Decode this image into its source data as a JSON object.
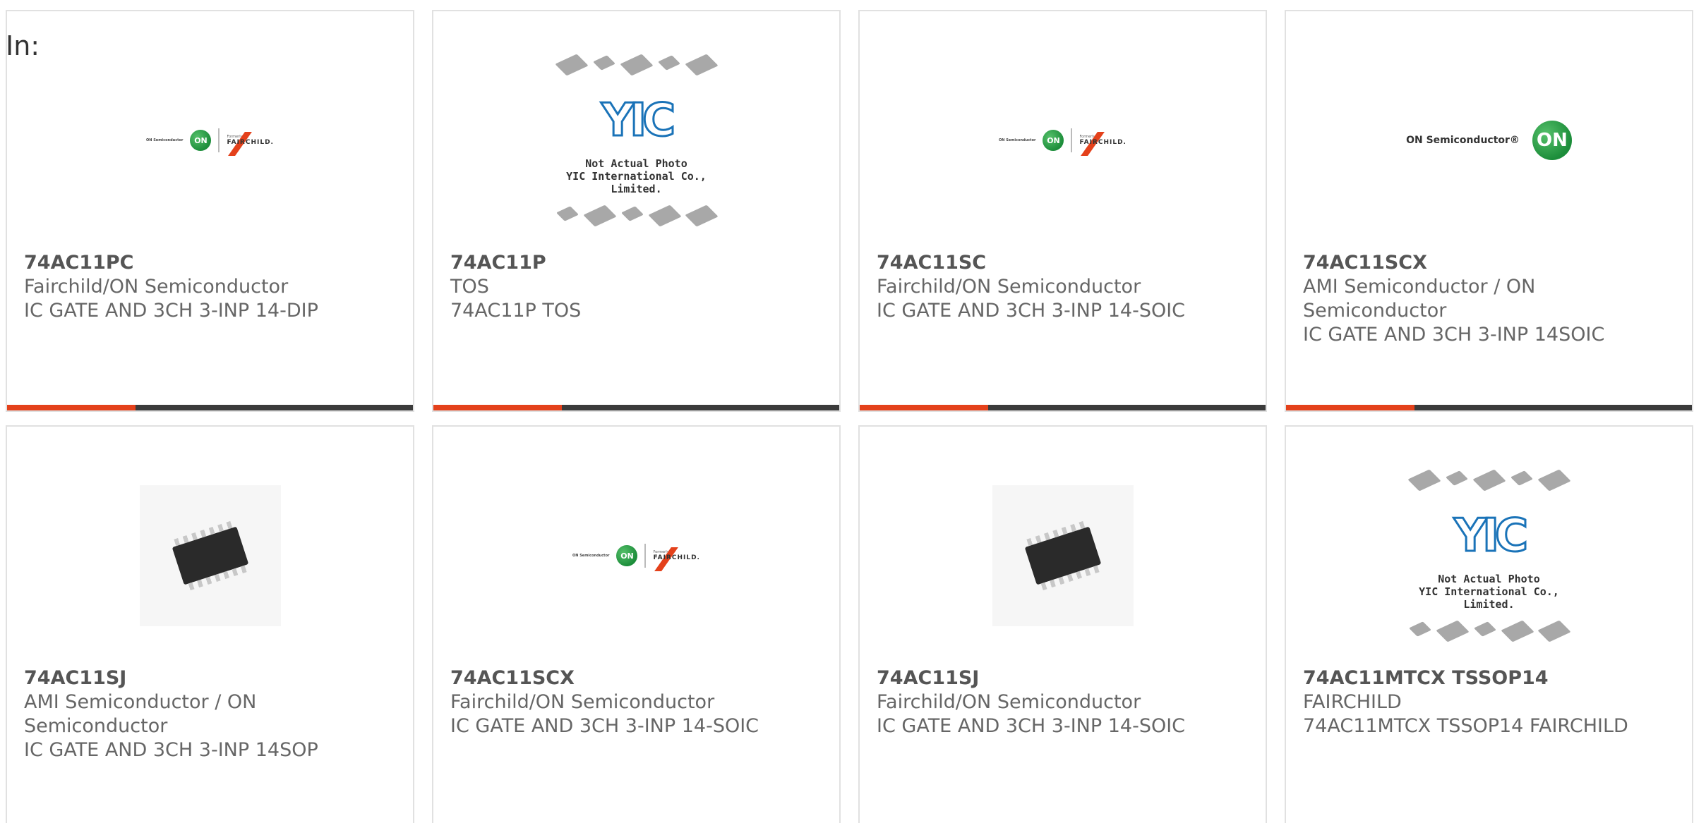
{
  "header": {
    "in_label": "In:"
  },
  "colors": {
    "accent": "#e4411b",
    "bar": "#3b3b3b",
    "border": "#e1e1e1"
  },
  "products": [
    {
      "part": "74AC11PC",
      "manufacturer": "Fairchild/ON Semiconductor",
      "description": "IC GATE AND 3CH 3-INP 14-DIP",
      "image": "fairchild-on-logo"
    },
    {
      "part": "74AC11P",
      "manufacturer": "TOS",
      "description": "74AC11P TOS",
      "image": "yic-not-actual-photo"
    },
    {
      "part": "74AC11SC",
      "manufacturer": "Fairchild/ON Semiconductor",
      "description": "IC GATE AND 3CH 3-INP 14-SOIC",
      "image": "fairchild-on-logo"
    },
    {
      "part": "74AC11SCX",
      "manufacturer": "AMI Semiconductor / ON Semiconductor",
      "description": "IC GATE AND 3CH 3-INP 14SOIC",
      "image": "on-semiconductor-logo"
    },
    {
      "part": "74AC11SJ",
      "manufacturer": "AMI Semiconductor / ON Semiconductor",
      "description": "IC GATE AND 3CH 3-INP 14SOP",
      "image": "ic-chip-photo"
    },
    {
      "part": "74AC11SCX",
      "manufacturer": "Fairchild/ON Semiconductor",
      "description": "IC GATE AND 3CH 3-INP 14-SOIC",
      "image": "fairchild-on-logo"
    },
    {
      "part": "74AC11SJ",
      "manufacturer": "Fairchild/ON Semiconductor",
      "description": "IC GATE AND 3CH 3-INP 14-SOIC",
      "image": "ic-chip-photo"
    },
    {
      "part": "74AC11MTCX TSSOP14",
      "manufacturer": "FAIRCHILD",
      "description": "74AC11MTCX TSSOP14 FAIRCHILD",
      "image": "yic-not-actual-photo"
    }
  ],
  "logos": {
    "on_semi_text": "ON Semiconductor",
    "on_semi_text_reg": "ON Semiconductor®",
    "on_mark": "ON",
    "formerly": "Formerly",
    "fairchild": "FAIRCHILD.",
    "yic_mark": "YIC",
    "yic_caption_1": "Not Actual Photo",
    "yic_caption_2": "YIC International Co., Limited."
  }
}
